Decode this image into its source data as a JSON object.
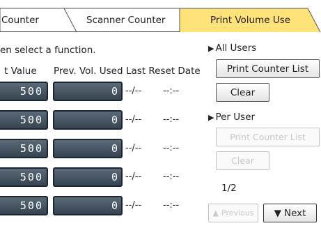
{
  "tabs": [
    {
      "label": "Counter",
      "active": false
    },
    {
      "label": "Scanner Counter",
      "active": false
    },
    {
      "label": "Print Volume Use",
      "active": true
    }
  ],
  "instruction": "en select a function.",
  "table": {
    "headers": [
      "t Value",
      "Prev. Vol. Used",
      "Last Reset Date"
    ],
    "rows": [
      {
        "limit": "500",
        "used": "0",
        "reset_date": "--/--",
        "reset_time": "--:--"
      },
      {
        "limit": "500",
        "used": "0",
        "reset_date": "--/--",
        "reset_time": "--:--"
      },
      {
        "limit": "500",
        "used": "0",
        "reset_date": "--/--",
        "reset_time": "--:--"
      },
      {
        "limit": "500",
        "used": "0",
        "reset_date": "--/--",
        "reset_time": "--:--"
      },
      {
        "limit": "500",
        "used": "0",
        "reset_date": "--/--",
        "reset_time": "--:--"
      }
    ]
  },
  "all_users": {
    "label": "All Users",
    "print_counter_list": "Print Counter List",
    "clear": "Clear"
  },
  "per_user": {
    "label": "Per User",
    "print_counter_list": "Print Counter List",
    "clear": "Clear",
    "enabled": false
  },
  "pagination": {
    "indicator": "1/2",
    "previous": "Previous",
    "next": "Next",
    "previous_enabled": false
  },
  "colors": {
    "active_tab": "#ffe37a",
    "value_box": "#3f4d5a",
    "tab_border": "#555555"
  },
  "icons": {
    "section_marker": "right-triangle-icon",
    "previous": "up-triangle-icon",
    "next": "down-triangle-icon"
  }
}
